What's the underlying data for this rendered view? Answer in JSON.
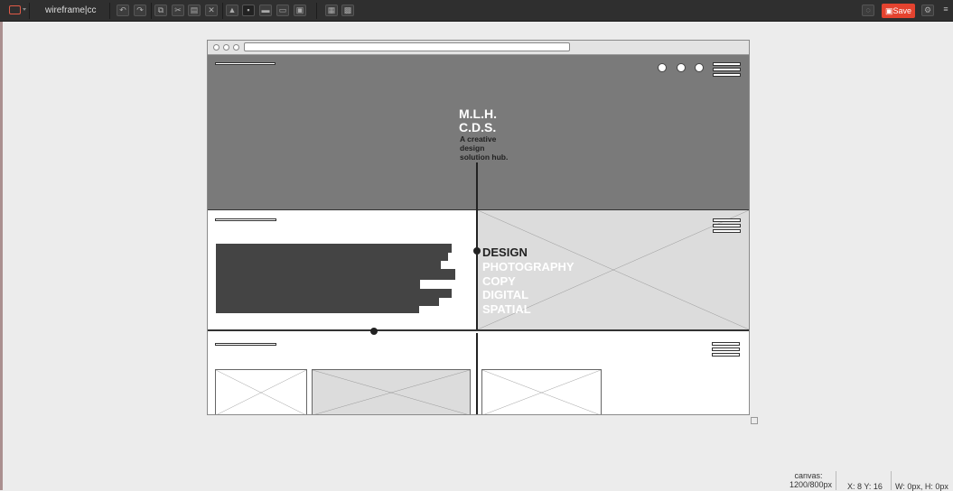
{
  "toolbar": {
    "title": "wireframe|cc",
    "save_label": "Save",
    "icons": [
      "app-menu-icon",
      "undo-icon",
      "redo-icon",
      "copy-icon",
      "cut-icon",
      "paste-icon",
      "delete-icon",
      "lock-icon",
      "bring-front-icon",
      "bring-forward-icon",
      "send-backward-icon",
      "send-back-icon",
      "group-icon",
      "ungroup-icon",
      "comment-icon",
      "settings-icon",
      "more-menu-icon"
    ],
    "accent_color": "#e4432f"
  },
  "wireframe": {
    "brand_line1": "M.L.H.",
    "brand_line2": "C.D.S.",
    "tagline": "A creative design solution hub.",
    "menu": [
      "DESIGN",
      "PHOTOGRAPHY",
      "COPY",
      "DIGITAL",
      "SPATIAL"
    ]
  },
  "status": {
    "canvas_label": "canvas:",
    "canvas_size": "1200/800px",
    "coords": "X: 8 Y: 16",
    "size": "W: 0px, H: 0px"
  }
}
